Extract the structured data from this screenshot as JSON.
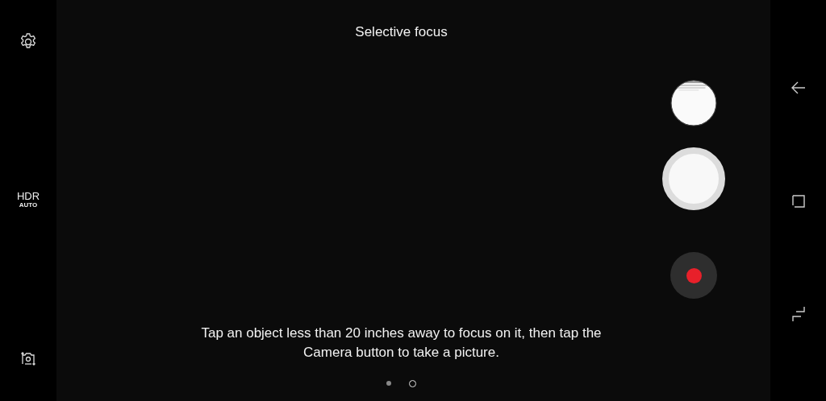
{
  "left_bar": {
    "hdr": {
      "label": "HDR",
      "mode": "AUTO"
    }
  },
  "mode_title": "Selective focus",
  "hint": "Tap an object less than 20 inches away to focus on it, then tap the Camera button to take a picture.",
  "pages": [
    {
      "selected": false
    },
    {
      "selected": true
    }
  ]
}
